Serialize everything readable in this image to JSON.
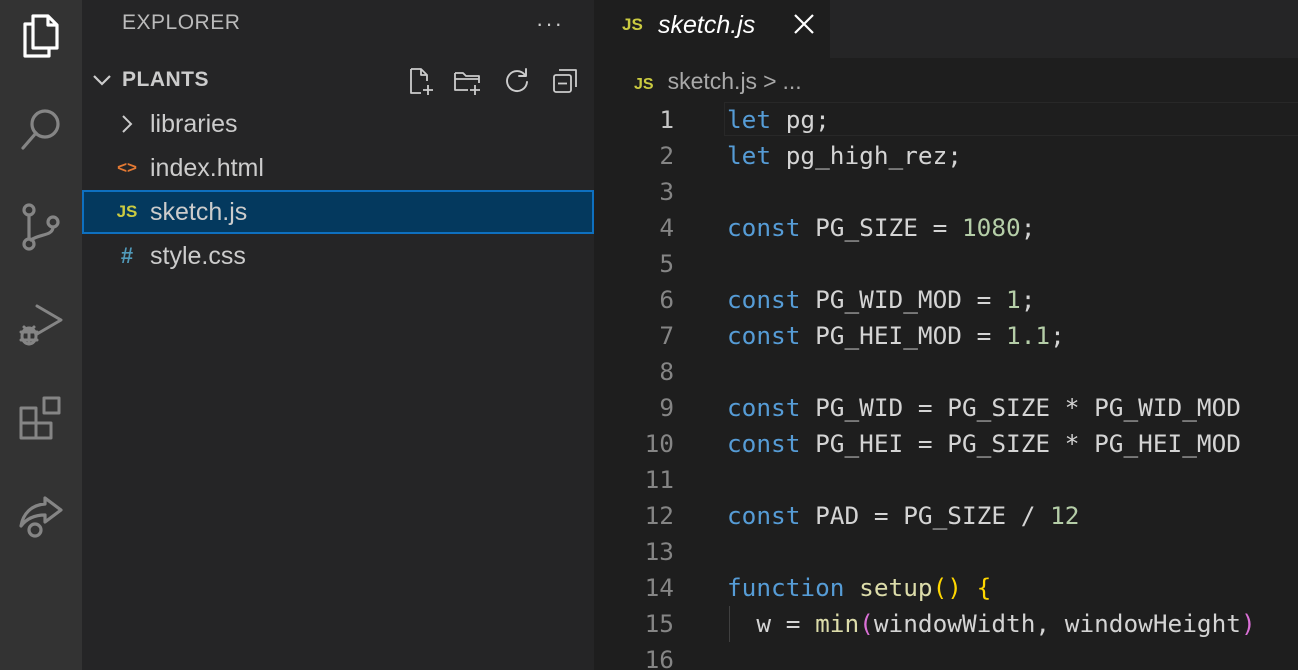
{
  "activity_bar": {
    "icons": [
      "explorer-icon",
      "search-icon",
      "source-control-icon",
      "run-debug-icon",
      "extensions-icon",
      "live-share-icon"
    ]
  },
  "sidebar": {
    "title": "EXPLORER",
    "more_label": "···",
    "section": {
      "title": "PLANTS",
      "actions": [
        "new-file-icon",
        "new-folder-icon",
        "refresh-icon",
        "collapse-all-icon"
      ]
    },
    "items": [
      {
        "label": "libraries",
        "icon": "chevron-right-icon",
        "type": "folder"
      },
      {
        "label": "index.html",
        "icon": "html-file-icon",
        "icon_text": "<>",
        "icon_color": "#e37933",
        "type": "file"
      },
      {
        "label": "sketch.js",
        "icon": "js-file-icon",
        "icon_text": "JS",
        "icon_color": "#cbcb41",
        "type": "file",
        "selected": true
      },
      {
        "label": "style.css",
        "icon": "css-file-icon",
        "icon_text": "#",
        "icon_color": "#519aba",
        "type": "file"
      }
    ]
  },
  "editor": {
    "tab": {
      "icon_text": "JS",
      "label": "sketch.js"
    },
    "breadcrumb": {
      "icon_text": "JS",
      "file": "sketch.js",
      "separator": ">",
      "rest": "..."
    },
    "colors": {
      "keyword": "#569cd6",
      "function": "#dcdcaa",
      "number": "#b5cea8",
      "variable": "#9cdcfe",
      "bracket_1": "#ffd700",
      "bracket_2": "#da70d6"
    },
    "lines": [
      {
        "n": "1",
        "tokens": [
          [
            "kw",
            "let"
          ],
          [
            "txt",
            " pg;"
          ]
        ]
      },
      {
        "n": "2",
        "tokens": [
          [
            "kw",
            "let"
          ],
          [
            "txt",
            " pg_high_rez;"
          ]
        ]
      },
      {
        "n": "3",
        "tokens": []
      },
      {
        "n": "4",
        "tokens": [
          [
            "kw",
            "const"
          ],
          [
            "txt",
            " PG_SIZE = "
          ],
          [
            "num",
            "1080"
          ],
          [
            "txt",
            ";"
          ]
        ]
      },
      {
        "n": "5",
        "tokens": []
      },
      {
        "n": "6",
        "tokens": [
          [
            "kw",
            "const"
          ],
          [
            "txt",
            " PG_WID_MOD = "
          ],
          [
            "num",
            "1"
          ],
          [
            "txt",
            ";"
          ]
        ]
      },
      {
        "n": "7",
        "tokens": [
          [
            "kw",
            "const"
          ],
          [
            "txt",
            " PG_HEI_MOD = "
          ],
          [
            "num",
            "1.1"
          ],
          [
            "txt",
            ";"
          ]
        ]
      },
      {
        "n": "8",
        "tokens": []
      },
      {
        "n": "9",
        "tokens": [
          [
            "kw",
            "const"
          ],
          [
            "txt",
            " PG_WID = PG_SIZE * PG_WID_MOD"
          ]
        ]
      },
      {
        "n": "10",
        "tokens": [
          [
            "kw",
            "const"
          ],
          [
            "txt",
            " PG_HEI = PG_SIZE * PG_HEI_MOD"
          ]
        ]
      },
      {
        "n": "11",
        "tokens": []
      },
      {
        "n": "12",
        "tokens": [
          [
            "kw",
            "const"
          ],
          [
            "txt",
            " PAD = PG_SIZE / "
          ],
          [
            "num",
            "12"
          ]
        ]
      },
      {
        "n": "13",
        "tokens": []
      },
      {
        "n": "14",
        "tokens": [
          [
            "kw",
            "function"
          ],
          [
            "txt",
            " "
          ],
          [
            "fn",
            "setup"
          ],
          [
            "br1",
            "()"
          ],
          [
            "txt",
            " "
          ],
          [
            "br1",
            "{"
          ]
        ]
      },
      {
        "n": "15",
        "tokens": [
          [
            "txt",
            "  w = "
          ],
          [
            "fn",
            "min"
          ],
          [
            "br2",
            "("
          ],
          [
            "txt",
            "windowWidth, windowHeight"
          ],
          [
            "br2",
            ")"
          ]
        ]
      },
      {
        "n": "16",
        "tokens": []
      }
    ]
  }
}
